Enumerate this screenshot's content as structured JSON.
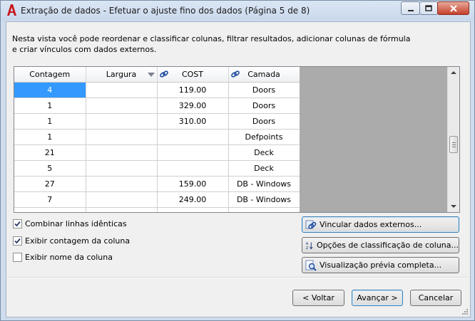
{
  "window": {
    "title": "Extração de dados - Efetuar o ajuste fino dos dados (Página 5 de 8)"
  },
  "description": "Nesta vista você pode reordenar e classificar colunas, filtrar resultados, adicionar colunas de fórmula e criar vínculos com dados externos.",
  "grid": {
    "columns": [
      "Contagem",
      "Largura",
      "COST",
      "Camada"
    ],
    "rows": [
      [
        "4",
        "",
        "119.00",
        "Doors"
      ],
      [
        "1",
        "",
        "329.00",
        "Doors"
      ],
      [
        "1",
        "",
        "310.00",
        "Doors"
      ],
      [
        "1",
        "",
        "",
        "Defpoints"
      ],
      [
        "21",
        "",
        "",
        "Deck"
      ],
      [
        "5",
        "",
        "",
        "Deck"
      ],
      [
        "27",
        "",
        "159.00",
        "DB - Windows"
      ],
      [
        "7",
        "",
        "249.00",
        "DB - Windows"
      ]
    ],
    "selected_row": 0
  },
  "options": {
    "combine_identical_rows": "Combinar linhas idênticas",
    "show_count_column": "Exibir contagem da coluna",
    "show_name_column": "Exibir nome da coluna"
  },
  "actions": {
    "link_external": "Vincular dados externos...",
    "sort_options": "Opções de classificação de coluna...",
    "full_preview": "Visualização prévia completa..."
  },
  "nav": {
    "back": "< Voltar",
    "next": "Avançar >",
    "cancel": "Cancelar"
  },
  "colors": {
    "selection": "#3399ff",
    "gray_pane": "#ababab",
    "brand_red": "#c8151b"
  }
}
